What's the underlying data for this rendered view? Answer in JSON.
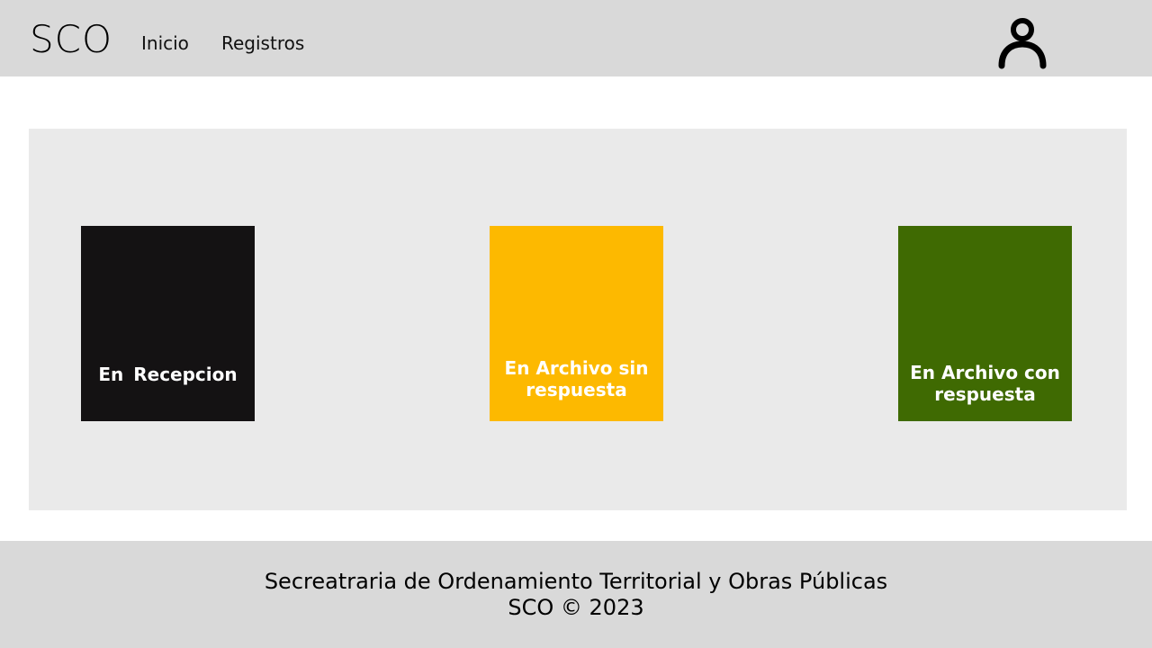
{
  "header": {
    "logo": "SCO",
    "nav": [
      {
        "label": "Inicio"
      },
      {
        "label": "Registros"
      }
    ],
    "user_icon": "user-account-icon"
  },
  "cards": [
    {
      "label": "En  Recepcion",
      "color": "#141213"
    },
    {
      "label": "En Archivo sin respuesta",
      "color": "#fdb900"
    },
    {
      "label": "En Archivo con respuesta",
      "color": "#3f6a02"
    }
  ],
  "footer": {
    "line1": "Secreatraria de Ordenamiento Territorial y Obras Públicas",
    "line2": "SCO © 2023"
  }
}
